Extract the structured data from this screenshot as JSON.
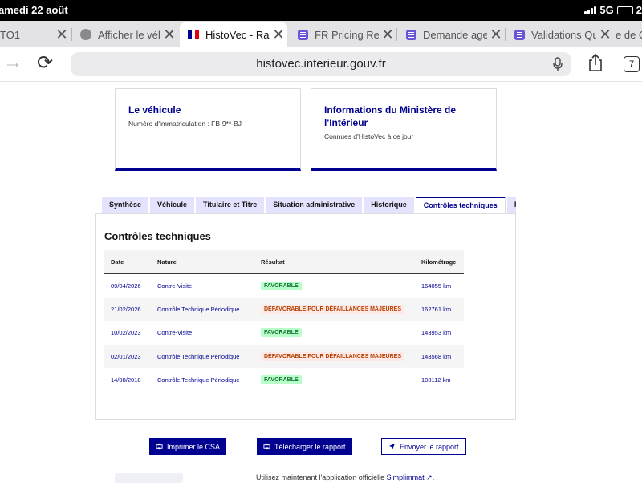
{
  "status_bar": {
    "date": "amedi 22 août",
    "network": "5G",
    "time": "2"
  },
  "tabs": [
    {
      "title": "TO1",
      "icon": "none"
    },
    {
      "title": "Afficher le véhi",
      "icon": "globe-icon"
    },
    {
      "title": "HistoVec - Rapp",
      "icon": "french-flag-icon"
    },
    {
      "title": "FR Pricing Requ",
      "icon": "form-icon"
    },
    {
      "title": "Demande agen",
      "icon": "form-icon"
    },
    {
      "title": "Validations Qu",
      "icon": "form-icon"
    },
    {
      "title": "e de C",
      "icon": "none"
    }
  ],
  "url": "histovec.interieur.gouv.fr",
  "tab_count": "7",
  "cards": {
    "vehicle": {
      "title": "Le véhicule",
      "text": "Numéro d'immatriculation : FB-9**-BJ"
    },
    "ministry": {
      "title": "Informations du Ministère de l'Intérieur",
      "text": "Connues d'HistoVec à ce jour"
    }
  },
  "page_tabs": [
    "Synthèse",
    "Véhicule",
    "Titulaire et Titre",
    "Situation administrative",
    "Historique",
    "Contrôles techniques",
    "Rap"
  ],
  "section_title": "Contrôles techniques",
  "table": {
    "headers": [
      "Date",
      "Nature",
      "Résultat",
      "Kilométrage"
    ],
    "rows": [
      {
        "date": "09/04/2026",
        "nature": "Contre-Visite",
        "result": "FAVORABLE",
        "km": "164055 km"
      },
      {
        "date": "21/02/2026",
        "nature": "Contrôle Technique Périodique",
        "result": "DÉFAVORABLE POUR DÉFAILLANCES MAJEURES",
        "km": "162761 km"
      },
      {
        "date": "10/02/2023",
        "nature": "Contre-Visite",
        "result": "FAVORABLE",
        "km": "143953 km"
      },
      {
        "date": "02/01/2023",
        "nature": "Contrôle Technique Périodique",
        "result": "DÉFAVORABLE POUR DÉFAILLANCES MAJEURES",
        "km": "143568 km"
      },
      {
        "date": "14/08/2018",
        "nature": "Contrôle Technique Périodique",
        "result": "FAVORABLE",
        "km": "108112 km"
      }
    ]
  },
  "buttons": {
    "print": "Imprimer le CSA",
    "download": "Télécharger le rapport",
    "send": "Envoyer le rapport"
  },
  "footer": {
    "text": "Utilisez maintenant l'application officielle ",
    "link": "Simplimmat"
  },
  "colors": {
    "primary": "#000091",
    "success_bg": "#b8fec9",
    "success_text": "#18753c",
    "error_bg": "#ffe9e6",
    "error_text": "#b34000"
  }
}
